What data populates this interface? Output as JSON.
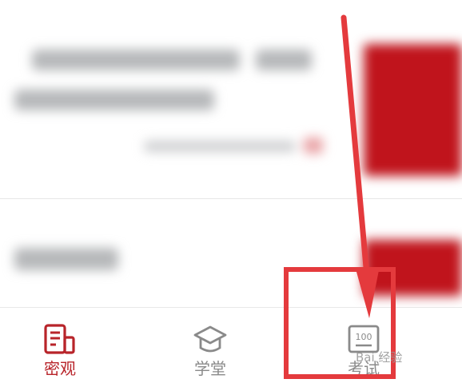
{
  "tabbar": {
    "tabs": [
      {
        "label": "密观",
        "icon": "newspaper-icon",
        "active": true
      },
      {
        "label": "学堂",
        "icon": "graduation-cap-icon",
        "active": false
      },
      {
        "label": "考试",
        "icon": "score-100-icon",
        "active": false
      }
    ],
    "score_icon_text": "100"
  },
  "colors": {
    "accent": "#b8242a",
    "inactive": "#8a8a8a",
    "annotation": "#e43a3d",
    "card_red": "#c0141c"
  },
  "watermark": "Bai 经验"
}
